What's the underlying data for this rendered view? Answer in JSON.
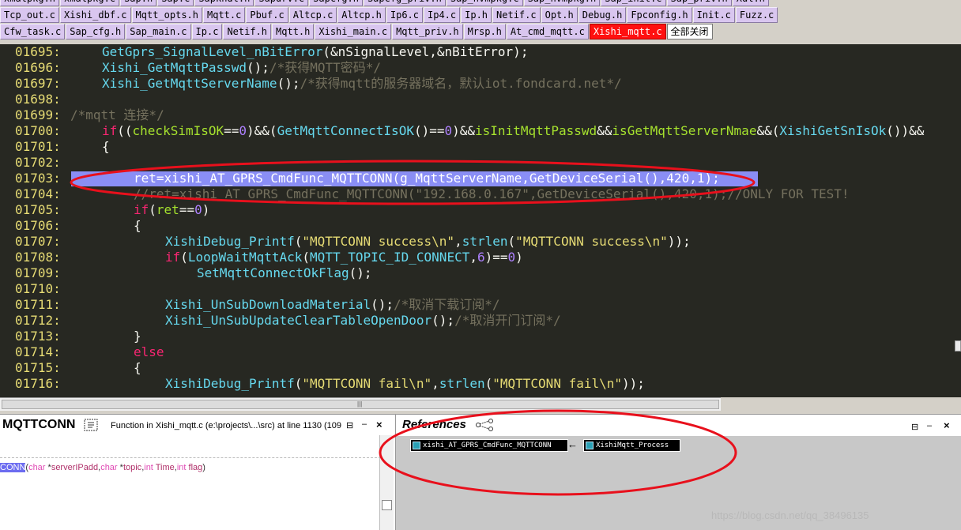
{
  "tabs": {
    "row0": [
      "xmalpkg.h",
      "xmalpkg.c",
      "Sap.h",
      "Sap.c",
      "Sapkhdl.h",
      "Sapdrv.c",
      "Sapcfg.h",
      "Sapcfg_priv.h",
      "Sap_nvmpkg.c",
      "Sap_nvmpkg.h",
      "Sap_init.c",
      "Sap_priv.h",
      "Xdl.h"
    ],
    "row1": [
      "Tcp_out.c",
      "Xishi_dbf.c",
      "Mqtt_opts.h",
      "Mqtt.c",
      "Pbuf.c",
      "Altcp.c",
      "Altcp.h",
      "Ip6.c",
      "Ip4.c",
      "Ip.h",
      "Netif.c",
      "Opt.h",
      "Debug.h",
      "Fpconfig.h",
      "Init.c",
      "Fuzz.c"
    ],
    "row2": [
      "Cfw_task.c",
      "Sap_cfg.h",
      "Sap_main.c",
      "Ip.c",
      "Netif.h",
      "Mqtt.h",
      "Xishi_main.c",
      "Mqtt_priv.h",
      "Mrsp.h",
      "At_cmd_mqtt.c",
      "Xishi_mqtt.c"
    ],
    "close_all": "全部关闭"
  },
  "editor": {
    "lines": [
      {
        "n": "01695:",
        "indent": 8,
        "parts": [
          [
            "fn",
            "GetGprs_SignalLevel_nBitError"
          ],
          [
            "plain",
            "(&nSignalLevel,&nBitError);"
          ]
        ]
      },
      {
        "n": "01696:",
        "indent": 8,
        "parts": [
          [
            "fn",
            "Xishi_GetMqttPasswd"
          ],
          [
            "plain",
            "();"
          ],
          [
            "cmt",
            "/*获得MQTT密码*/"
          ]
        ]
      },
      {
        "n": "01697:",
        "indent": 8,
        "parts": [
          [
            "fn",
            "Xishi_GetMqttServerName"
          ],
          [
            "plain",
            "();"
          ],
          [
            "cmt",
            "/*获得mqtt的服务器域名，默认iot.fondcard.net*/"
          ]
        ]
      },
      {
        "n": "01698:",
        "indent": 0,
        "parts": []
      },
      {
        "n": "01699:",
        "indent": 0,
        "parts": [
          [
            "cmt",
            "/*mqtt 连接*/"
          ]
        ]
      },
      {
        "n": "01700:",
        "indent": 8,
        "parts": [
          [
            "kw",
            "if"
          ],
          [
            "plain",
            "(("
          ],
          [
            "var",
            "checkSimIsOK"
          ],
          [
            "plain",
            "=="
          ],
          [
            "num",
            "0"
          ],
          [
            "plain",
            ")&&("
          ],
          [
            "fn",
            "GetMqttConnectIsOK"
          ],
          [
            "plain",
            "()=="
          ],
          [
            "num",
            "0"
          ],
          [
            "plain",
            ")&&"
          ],
          [
            "var",
            "isInitMqttPasswd"
          ],
          [
            "plain",
            "&&"
          ],
          [
            "var",
            "isGetMqttServerNmae"
          ],
          [
            "plain",
            "&&("
          ],
          [
            "fn",
            "XishiGetSnIsOk"
          ],
          [
            "plain",
            "())&&"
          ]
        ]
      },
      {
        "n": "01701:",
        "indent": 8,
        "parts": [
          [
            "plain",
            "{"
          ]
        ]
      },
      {
        "n": "01702:",
        "indent": 0,
        "parts": []
      },
      {
        "n": "01703:",
        "indent": 16,
        "highlight": true,
        "parts": [
          [
            "hl",
            "ret=xishi_AT_GPRS_CmdFunc_MQTTCONN(g_MqttServerName,GetDeviceSerial(),420,1);"
          ]
        ]
      },
      {
        "n": "01704:",
        "indent": 16,
        "parts": [
          [
            "cmt",
            "//ret=xishi_AT_GPRS_CmdFunc_MQTTCONN(\"192.168.0.167\",GetDeviceSerial(),420,1);//ONLY FOR TEST!"
          ]
        ]
      },
      {
        "n": "01705:",
        "indent": 16,
        "parts": [
          [
            "kw",
            "if"
          ],
          [
            "plain",
            "("
          ],
          [
            "var",
            "ret"
          ],
          [
            "plain",
            "=="
          ],
          [
            "num",
            "0"
          ],
          [
            "plain",
            ")"
          ]
        ]
      },
      {
        "n": "01706:",
        "indent": 16,
        "parts": [
          [
            "plain",
            "{"
          ]
        ]
      },
      {
        "n": "01707:",
        "indent": 24,
        "parts": [
          [
            "fn",
            "XishiDebug_Printf"
          ],
          [
            "plain",
            "("
          ],
          [
            "str",
            "\"MQTTCONN success\\n\""
          ],
          [
            "plain",
            ","
          ],
          [
            "fn",
            "strlen"
          ],
          [
            "plain",
            "("
          ],
          [
            "str",
            "\"MQTTCONN success\\n\""
          ],
          [
            "plain",
            "));"
          ]
        ]
      },
      {
        "n": "01708:",
        "indent": 24,
        "parts": [
          [
            "kw",
            "if"
          ],
          [
            "plain",
            "("
          ],
          [
            "fn",
            "LoopWaitMqttAck"
          ],
          [
            "plain",
            "("
          ],
          [
            "fn",
            "MQTT_TOPIC_ID_CONNECT"
          ],
          [
            "plain",
            ","
          ],
          [
            "num",
            "6"
          ],
          [
            "plain",
            ")=="
          ],
          [
            "num",
            "0"
          ],
          [
            "plain",
            ")"
          ]
        ]
      },
      {
        "n": "01709:",
        "indent": 32,
        "parts": [
          [
            "fn",
            "SetMqttConnectOkFlag"
          ],
          [
            "plain",
            "();"
          ]
        ]
      },
      {
        "n": "01710:",
        "indent": 0,
        "parts": []
      },
      {
        "n": "01711:",
        "indent": 24,
        "parts": [
          [
            "fn",
            "Xishi_UnSubDownloadMaterial"
          ],
          [
            "plain",
            "();"
          ],
          [
            "cmt",
            "/*取消下载订阅*/"
          ]
        ]
      },
      {
        "n": "01712:",
        "indent": 24,
        "parts": [
          [
            "fn",
            "Xishi_UnSubUpdateClearTableOpenDoor"
          ],
          [
            "plain",
            "();"
          ],
          [
            "cmt",
            "/*取消开门订阅*/"
          ]
        ]
      },
      {
        "n": "01713:",
        "indent": 16,
        "parts": [
          [
            "plain",
            "}"
          ]
        ]
      },
      {
        "n": "01714:",
        "indent": 16,
        "parts": [
          [
            "kw",
            "else"
          ]
        ]
      },
      {
        "n": "01715:",
        "indent": 16,
        "parts": [
          [
            "plain",
            "{"
          ]
        ]
      },
      {
        "n": "01716:",
        "indent": 24,
        "parts": [
          [
            "fn",
            "XishiDebug_Printf"
          ],
          [
            "plain",
            "("
          ],
          [
            "str",
            "\"MQTTCONN fail\\n\""
          ],
          [
            "plain",
            ","
          ],
          [
            "fn",
            "strlen"
          ],
          [
            "plain",
            "("
          ],
          [
            "str",
            "\"MQTTCONN fail\\n\""
          ],
          [
            "plain",
            "));"
          ]
        ]
      }
    ],
    "scroll_grip": "|||"
  },
  "symbol_panel": {
    "name": "MQTTCONN",
    "icon": "symbol-window-icon",
    "description": "Function in Xishi_mqtt.c (e:\\projects\\...\\src) at line 1130 (109",
    "pin": "⊟",
    "minimize": "–",
    "close": "×",
    "signature": {
      "name": "CONN",
      "open": "(",
      "params": [
        {
          "type": "char",
          "sep": " *",
          "name": "serverIPadd",
          "after": ","
        },
        {
          "type": "char",
          "sep": " *",
          "name": "topic",
          "after": ","
        },
        {
          "type": "int",
          "sep": " ",
          "name": "Time",
          "after": ","
        },
        {
          "type": "int",
          "sep": " ",
          "name": "flag",
          "after": ")"
        }
      ]
    }
  },
  "references_panel": {
    "title": "References",
    "icon": "relation-graph-icon",
    "pin": "⊟",
    "minimize": "–",
    "close": "×",
    "nodes": [
      {
        "label": "xishi_AT_GPRS_CmdFunc_MQTTCONN"
      },
      {
        "label": "XishiMqtt_Process"
      }
    ],
    "arrow": "←",
    "watermark": "https://blog.csdn.net/qq_38496135"
  },
  "colors": {
    "editor_bg": "#272822",
    "line_number": "#e6db74",
    "highlight_bg": "#8a8ef5",
    "active_tab": "#ff1010",
    "annotation": "#e8101c"
  }
}
